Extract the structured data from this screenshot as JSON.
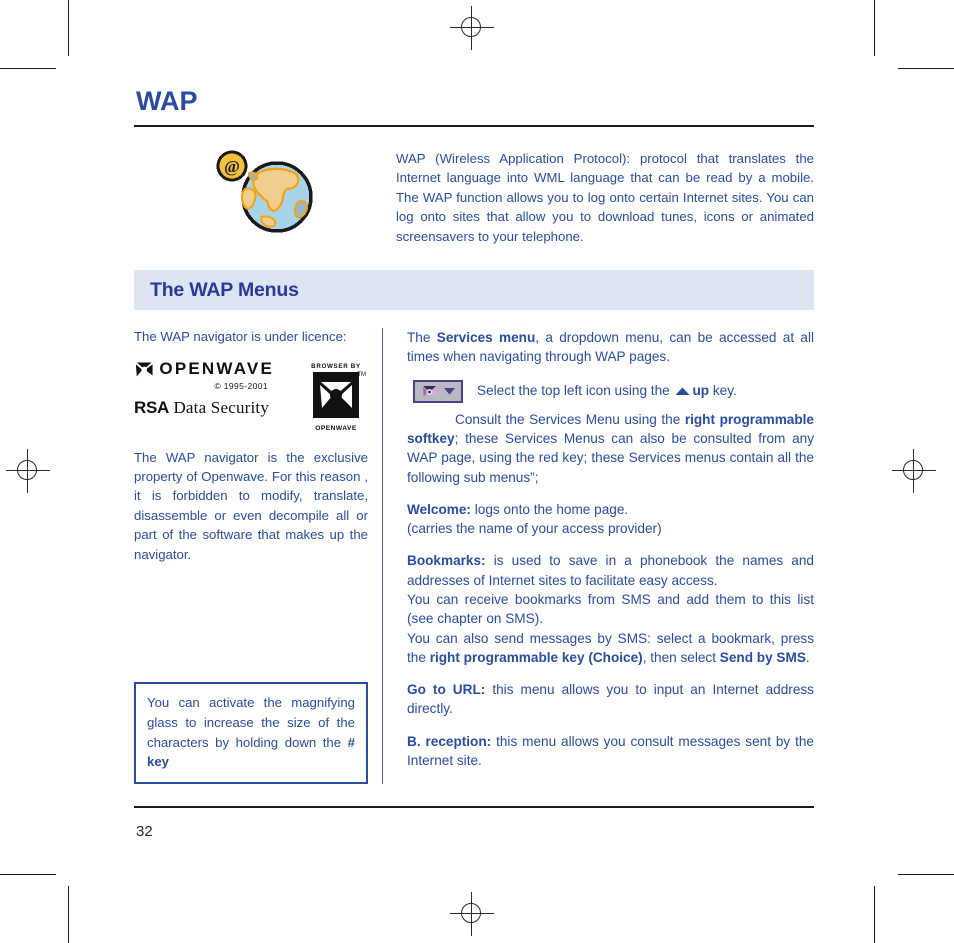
{
  "document": {
    "title": "WAP",
    "page_number": "32",
    "colors": {
      "heading_blue": "#2a4ca0",
      "band_bg": "#dde4f2",
      "band_text": "#2a3a94",
      "rule": "#1b1b1b"
    }
  },
  "intro": {
    "icon_name": "globe-at-symbol-icon",
    "text": "WAP (Wireless Application Protocol): protocol that translates the Internet language into WML language that can be read by a mobile. The WAP function allows you to log onto certain Internet sites. You can log onto sites that allow you to download tunes, icons or animated screensavers to your telephone."
  },
  "section": {
    "band_title": "The WAP Menus"
  },
  "left_column": {
    "licence_line": "The WAP navigator is under licence:",
    "logos": {
      "openwave_wordmark": "OPENWAVE",
      "openwave_copyright": "© 1995-2001",
      "rsa_bold": "RSA",
      "rsa_rest": "Data Security",
      "browser_by_label": "BROWSER BY",
      "badge_trademark": "TM",
      "badge_label": "OPENWAVE"
    },
    "paragraph": "The WAP navigator is the exclusive property of Openwave. For this reason , it is forbidden to modify, translate, disassemble or even decompile all or part of the software that makes up the navigator.",
    "tipbox": {
      "text_before": "You can activate the magnifying glass to increase the size of the characters by holding down the ",
      "text_bold": "# key"
    }
  },
  "right_column": {
    "services_intro": {
      "pre": "The ",
      "bold": "Services menu",
      "post": ", a dropdown menu, can be accessed at all times when navigating through WAP pages."
    },
    "select_icon_line": {
      "pre": "Select the  top left icon using the ",
      "arrow_icon": "up-arrow-icon",
      "bold": "up",
      "post": " key."
    },
    "dropdown_icon": {
      "name": "services-dropdown-icon",
      "glyph": "pinwheel-icon",
      "caret": "chevron-down-icon"
    },
    "consult_para": {
      "pre": "Consult the Services Menu using the ",
      "bold": "right programmable softkey",
      "post": "; these Services Menus can also be consulted from any WAP page, using the red key; these Services menus contain all the following sub menus”;"
    },
    "menu_items": [
      {
        "label": "Welcome:",
        "text": " logs onto the home page.",
        "extra_lines": [
          "(carries the name of your access provider)"
        ]
      },
      {
        "label": "Bookmarks:",
        "text": " is used to save in a phonebook the names and addresses of Internet sites to facilitate easy access.",
        "extra_lines": [
          "You can receive bookmarks from SMS and add them to this list (see chapter on SMS)."
        ],
        "rich_tail": {
          "pre": "You can also send messages by SMS: select a bookmark, press the ",
          "bold1": "right programmable key (Choice)",
          "mid": ", then select ",
          "bold2": "Send by SMS",
          "post": "."
        }
      },
      {
        "label": "Go to URL:",
        "text": " this menu allows you to input an Internet address directly.",
        "extra_lines": []
      },
      {
        "label": "B. reception:",
        "text": " this menu allows you consult messages sent by the Internet site.",
        "extra_lines": []
      }
    ]
  }
}
